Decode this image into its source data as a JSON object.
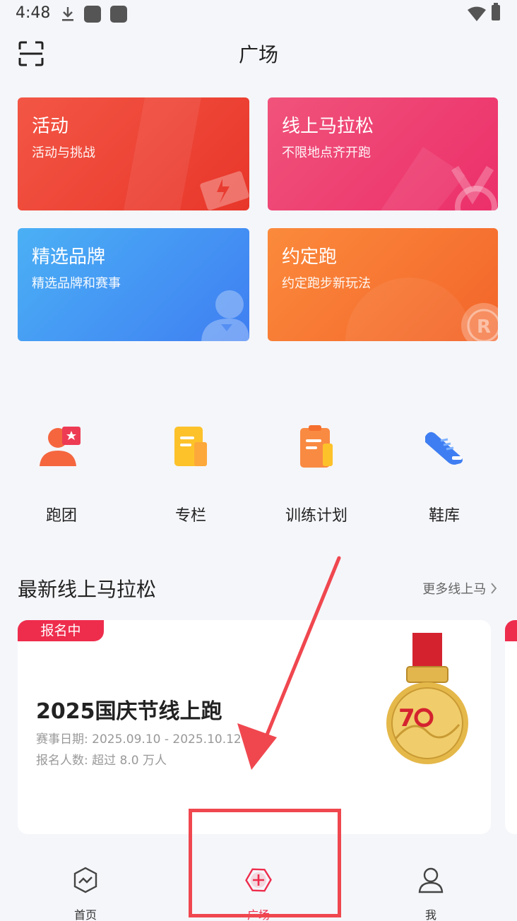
{
  "status_bar": {
    "time": "4:48"
  },
  "header": {
    "title": "广场"
  },
  "cards": [
    {
      "title": "活动",
      "subtitle": "活动与挑战"
    },
    {
      "title": "线上马拉松",
      "subtitle": "不限地点齐开跑"
    },
    {
      "title": "精选品牌",
      "subtitle": "精选品牌和赛事"
    },
    {
      "title": "约定跑",
      "subtitle": "约定跑步新玩法"
    }
  ],
  "quick_links": [
    {
      "label": "跑团",
      "icon": "running-group-icon"
    },
    {
      "label": "专栏",
      "icon": "column-icon"
    },
    {
      "label": "训练计划",
      "icon": "training-plan-icon"
    },
    {
      "label": "鞋库",
      "icon": "shoe-icon"
    }
  ],
  "section": {
    "title": "最新线上马拉松",
    "more": "更多线上马"
  },
  "race": {
    "badge": "报名中",
    "title": "2025国庆节线上跑",
    "date": "赛事日期:  2025.09.10 - 2025.10.12",
    "participants": "报名人数:  超过 8.0 万人"
  },
  "tabs": [
    {
      "label": "首页",
      "icon": "home-icon"
    },
    {
      "label": "广场",
      "icon": "plaza-plus-icon",
      "active": true
    },
    {
      "label": "我",
      "icon": "profile-icon"
    }
  ],
  "colors": {
    "accent": "#ee2d4d",
    "annotation": "#f0474f"
  }
}
